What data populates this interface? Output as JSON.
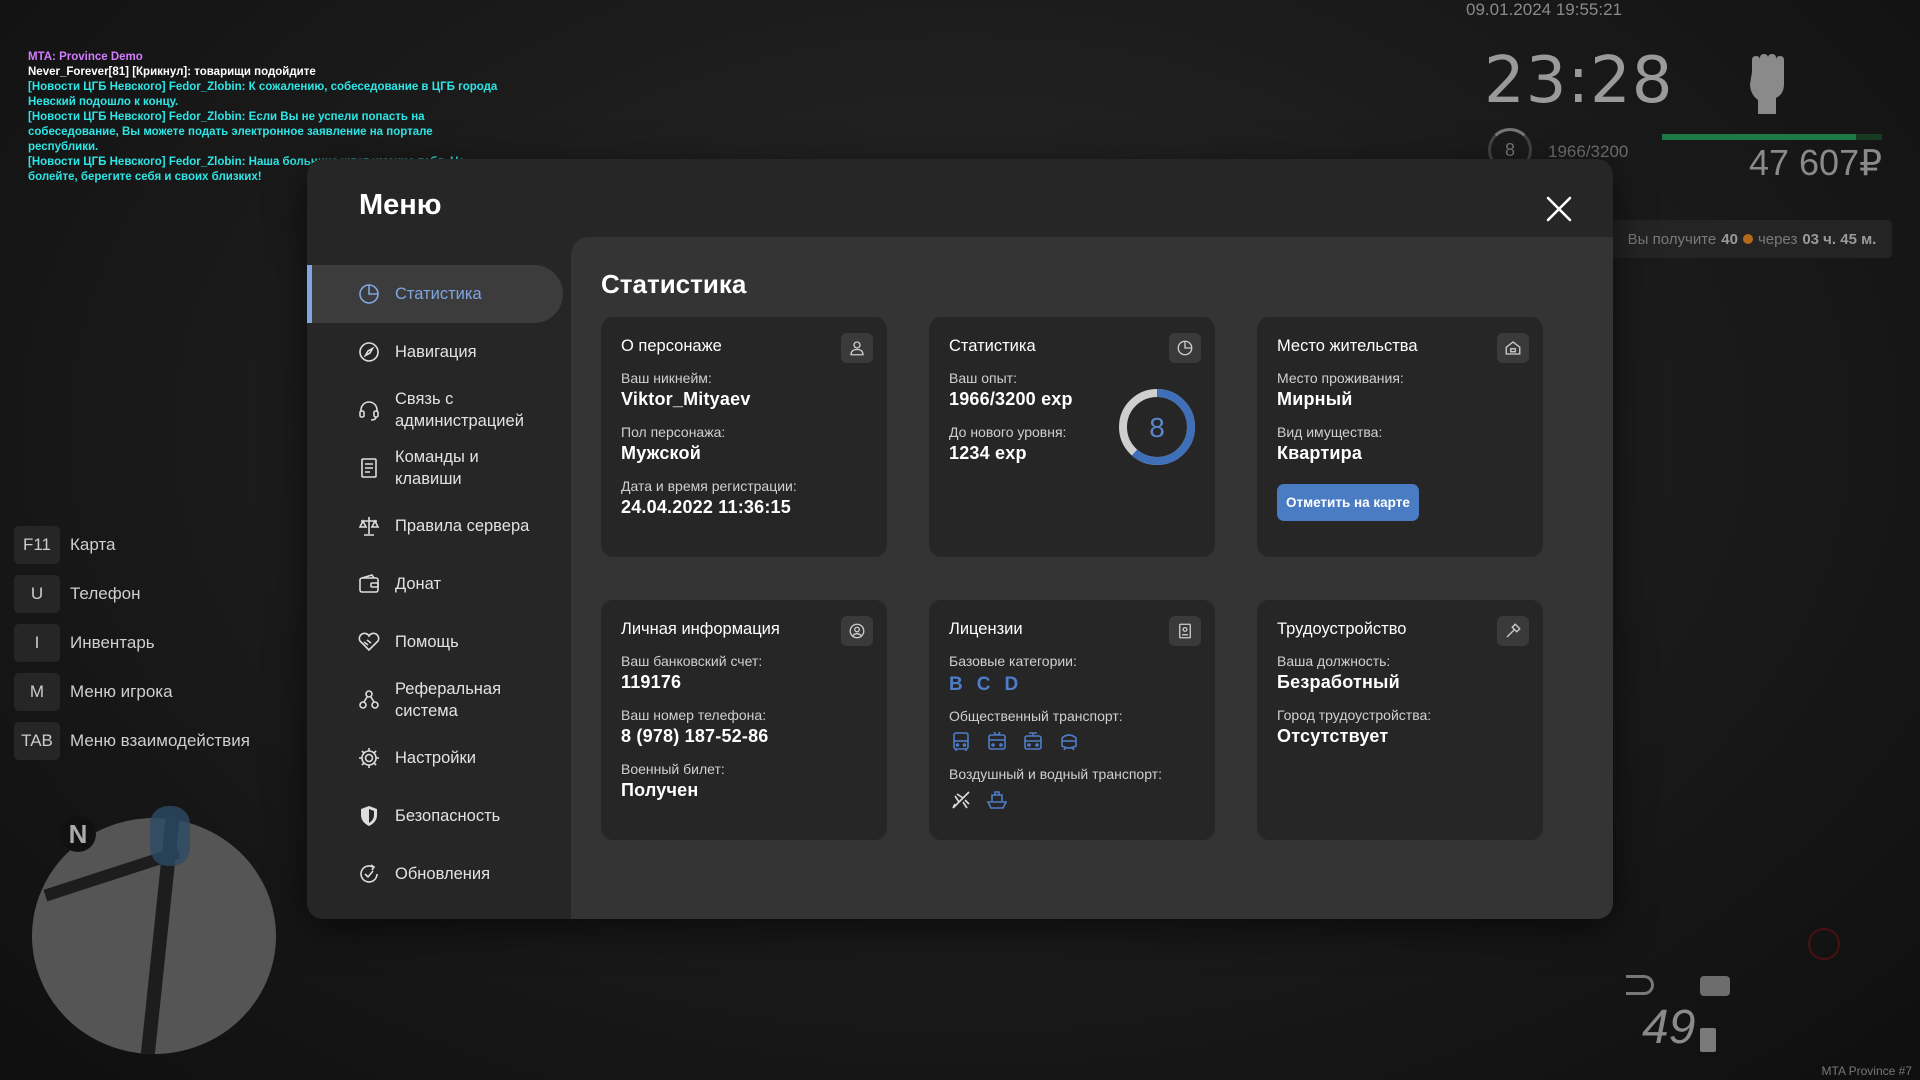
{
  "chat": {
    "server_line": "MTA: Province Demo",
    "lines": [
      {
        "type": "plain",
        "text": "Never_Forever[81] [Крикнул]: товарищи подойдите"
      },
      {
        "type": "news",
        "text": "[Новости ЦГБ Невского] Fedor_Zlobin: К сожалению, собеседование в ЦГБ города Невский подошло к концу."
      },
      {
        "type": "news",
        "text": "[Новости ЦГБ Невского] Fedor_Zlobin: Если Вы не успели попасть на собеседование, Вы можете подать электронное заявление на портале республики."
      },
      {
        "type": "news",
        "text": "[Новости ЦГБ Невского] Fedor_Zlobin: Наша больница ждет именно тебя. Не болейте, берегите себя и своих близких!"
      }
    ]
  },
  "hud": {
    "datetime": "09.01.2024 19:55:21",
    "clock": "23:28",
    "level": "8",
    "xp": "1966/3200",
    "health_fraction": 0.88,
    "money": "47 607₽",
    "reward_prefix": "Вы получите",
    "reward_amount": "40",
    "reward_suffix": "через",
    "reward_time": "03 ч. 45 м.",
    "speed": "49",
    "watermark": "MTA Province #7"
  },
  "hotkeys": [
    {
      "key": "F11",
      "label": "Карта"
    },
    {
      "key": "U",
      "label": "Телефон"
    },
    {
      "key": "I",
      "label": "Инвентарь"
    },
    {
      "key": "M",
      "label": "Меню игрока"
    },
    {
      "key": "TAB",
      "label": "Меню взаимодействия"
    }
  ],
  "minimap": {
    "compass": "N"
  },
  "menu": {
    "title": "Меню",
    "nav": [
      {
        "label": "Статистика",
        "icon": "pie-chart-icon"
      },
      {
        "label": "Навигация",
        "icon": "compass-icon"
      },
      {
        "label": "Связь с администрацией",
        "icon": "headset-icon"
      },
      {
        "label": "Команды и клавиши",
        "icon": "document-icon"
      },
      {
        "label": "Правила сервера",
        "icon": "scales-icon"
      },
      {
        "label": "Донат",
        "icon": "wallet-icon"
      },
      {
        "label": "Помощь",
        "icon": "handshake-icon"
      },
      {
        "label": "Реферальная система",
        "icon": "referral-icon"
      },
      {
        "label": "Настройки",
        "icon": "gear-icon"
      },
      {
        "label": "Безопасность",
        "icon": "shield-icon"
      },
      {
        "label": "Обновления",
        "icon": "refresh-check-icon"
      }
    ],
    "content_title": "Статистика",
    "character": {
      "title": "О персонаже",
      "nick_label": "Ваш никнейм:",
      "nick": "Viktor_Mityaev",
      "gender_label": "Пол персонажа:",
      "gender": "Мужской",
      "reg_label": "Дата и время регистрации:",
      "reg": "24.04.2022 11:36:15"
    },
    "stats": {
      "title": "Статистика",
      "exp_label": "Ваш опыт:",
      "exp": "1966/3200 exp",
      "next_label": "До нового уровня:",
      "next": "1234 exp",
      "level": "8",
      "progress_fraction": 0.614
    },
    "residence": {
      "title": "Место жительства",
      "place_label": "Место проживания:",
      "place": "Мирный",
      "property_label": "Вид имущества:",
      "property": "Квартира",
      "button": "Отметить на карте"
    },
    "personal": {
      "title": "Личная информация",
      "bank_label": "Ваш банковский счет:",
      "bank": "119176",
      "phone_label": "Ваш номер телефона:",
      "phone": "8 (978) 187-52-86",
      "military_label": "Военный билет:",
      "military": "Получен"
    },
    "licenses": {
      "title": "Лицензии",
      "base_label": "Базовые категории:",
      "categories": [
        "B",
        "C",
        "D"
      ],
      "public_label": "Общественный транспорт:",
      "public_icons": [
        "bus-icon",
        "trolleybus-icon",
        "tram-icon",
        "metro-icon"
      ],
      "air_label": "Воздушный и водный транспорт:",
      "air_icons": [
        "airplane-icon",
        "boat-icon"
      ]
    },
    "employment": {
      "title": "Трудоустройство",
      "position_label": "Ваша должность:",
      "position": "Безработный",
      "city_label": "Город трудоустройства:",
      "city": "Отсутствует"
    }
  },
  "colors": {
    "accent": "#7fa6e0",
    "button": "#4a7cc4",
    "category": "#4f7dc9",
    "panel": "#262626",
    "content": "#343434"
  }
}
